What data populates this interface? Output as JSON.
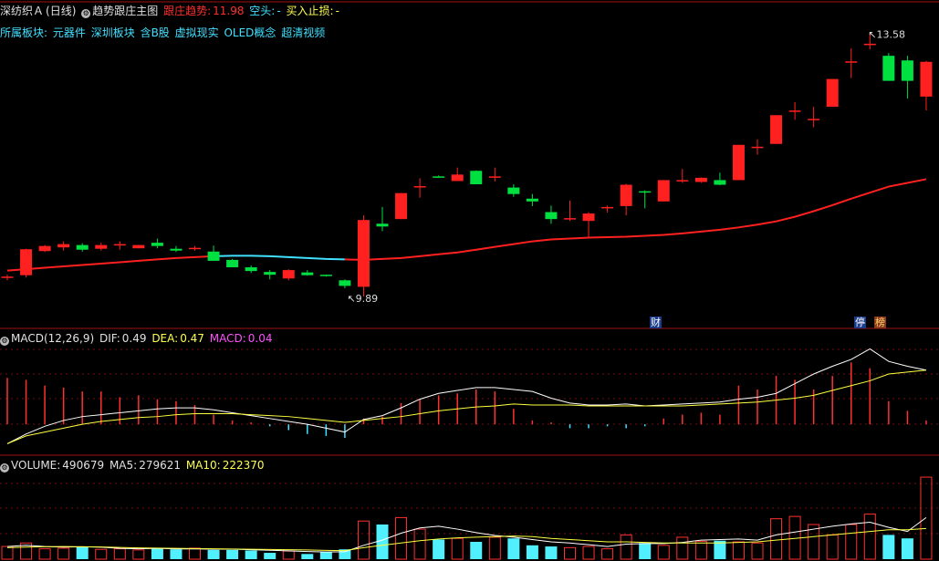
{
  "header": {
    "stock": "深纺织Ａ",
    "period": "(日线)",
    "main_name": "趋势跟庄主图",
    "trend_label": "跟庄趋势:",
    "trend_value": "11.98",
    "short_label": "空头:",
    "short_value": "-",
    "buy_label": "买入止损:",
    "buy_value": "-",
    "sector_label": "所属板块:",
    "sectors": [
      "元器件",
      "深圳板块",
      "含B股",
      "虚拟现实",
      "OLED概念",
      "超清视频"
    ]
  },
  "markers": {
    "cai": "财",
    "ting": "停",
    "bang": "榜"
  },
  "macd_header": {
    "name": "MACD(12,26,9)",
    "dif_label": "DIF:",
    "dif": "0.49",
    "dea_label": "DEA:",
    "dea": "0.47",
    "macd_label": "MACD:",
    "macd": "0.04"
  },
  "vol_header": {
    "name": "VOLUME:",
    "vol": "490679",
    "ma5_label": "MA5:",
    "ma5": "279621",
    "ma10_label": "MA10:",
    "ma10": "222370"
  },
  "colors": {
    "up": "#ff2020",
    "down": "#00e040",
    "trend_line": "#ff2020",
    "trend_line_alt": "#40e0ff",
    "dif": "#ffffff",
    "dea": "#ffff40"
  },
  "chart_data": [
    {
      "type": "candlestick",
      "name": "price",
      "annotations": [
        {
          "label": "13.58",
          "kind": "high"
        },
        {
          "label": "9.89",
          "kind": "low"
        }
      ],
      "ohlc": [
        [
          10.31,
          10.36,
          10.24,
          10.32
        ],
        [
          10.35,
          10.92,
          10.3,
          10.91
        ],
        [
          10.87,
          11.0,
          10.85,
          10.98
        ],
        [
          10.95,
          11.08,
          10.88,
          11.02
        ],
        [
          11.0,
          11.04,
          10.86,
          10.9
        ],
        [
          10.92,
          11.05,
          10.88,
          11.0
        ],
        [
          10.99,
          11.08,
          10.9,
          11.02
        ],
        [
          10.93,
          11.0,
          10.93,
          11.0
        ],
        [
          11.05,
          11.14,
          10.93,
          10.98
        ],
        [
          10.92,
          10.98,
          10.85,
          10.88
        ],
        [
          10.92,
          10.98,
          10.88,
          10.94
        ],
        [
          10.86,
          10.99,
          10.66,
          10.66
        ],
        [
          10.68,
          10.7,
          10.52,
          10.52
        ],
        [
          10.52,
          10.56,
          10.4,
          10.44
        ],
        [
          10.42,
          10.46,
          10.26,
          10.36
        ],
        [
          10.28,
          10.48,
          10.24,
          10.46
        ],
        [
          10.41,
          10.46,
          10.34,
          10.35
        ],
        [
          10.36,
          10.36,
          10.32,
          10.34
        ],
        [
          10.24,
          10.26,
          10.07,
          10.12
        ],
        [
          10.1,
          11.64,
          9.89,
          11.54
        ],
        [
          11.46,
          11.82,
          11.3,
          11.4
        ],
        [
          11.56,
          12.12,
          11.56,
          12.12
        ],
        [
          12.26,
          12.44,
          12.02,
          12.27
        ],
        [
          12.48,
          12.5,
          12.46,
          12.47
        ],
        [
          12.38,
          12.67,
          12.38,
          12.52
        ],
        [
          12.6,
          12.61,
          12.31,
          12.31
        ],
        [
          12.46,
          12.67,
          12.37,
          12.48
        ],
        [
          12.24,
          12.31,
          12.04,
          12.1
        ],
        [
          12.0,
          12.1,
          11.84,
          11.94
        ],
        [
          11.71,
          11.85,
          11.46,
          11.56
        ],
        [
          11.58,
          11.96,
          11.52,
          11.58
        ],
        [
          11.52,
          11.71,
          11.18,
          11.68
        ],
        [
          11.8,
          11.85,
          11.7,
          11.82
        ],
        [
          11.84,
          12.32,
          11.64,
          12.3
        ],
        [
          12.16,
          12.18,
          11.79,
          12.15
        ],
        [
          11.94,
          12.4,
          11.94,
          12.4
        ],
        [
          12.39,
          12.64,
          12.34,
          12.4
        ],
        [
          12.36,
          12.46,
          12.34,
          12.45
        ],
        [
          12.4,
          12.56,
          12.29,
          12.3
        ],
        [
          12.4,
          13.16,
          12.4,
          13.16
        ],
        [
          13.12,
          13.28,
          12.95,
          13.12
        ],
        [
          13.18,
          13.8,
          13.18,
          13.8
        ],
        [
          13.9,
          14.08,
          13.7,
          13.9
        ],
        [
          13.72,
          13.98,
          13.54,
          13.72
        ],
        [
          13.98,
          14.58,
          13.98,
          14.58
        ],
        [
          14.96,
          15.24,
          14.6,
          14.96
        ],
        [
          15.34,
          15.55,
          15.22,
          15.34
        ],
        [
          15.08,
          15.14,
          14.54,
          14.54
        ],
        [
          14.98,
          15.08,
          14.16,
          14.54
        ],
        [
          14.2,
          14.97,
          13.9,
          14.95
        ]
      ],
      "trend_line": [
        10.45,
        10.48,
        10.51,
        10.54,
        10.57,
        10.6,
        10.63,
        10.66,
        10.69,
        10.72,
        10.74,
        10.76,
        10.77,
        10.77,
        10.76,
        10.74,
        10.72,
        10.7,
        10.69,
        10.68,
        10.7,
        10.72,
        10.76,
        10.8,
        10.84,
        10.9,
        10.96,
        11.02,
        11.08,
        11.12,
        11.14,
        11.16,
        11.17,
        11.18,
        11.2,
        11.22,
        11.25,
        11.29,
        11.33,
        11.38,
        11.44,
        11.51,
        11.61,
        11.73,
        11.86,
        12.0,
        12.13,
        12.26,
        12.34,
        12.42
      ],
      "trend_alt_range": [
        11,
        18
      ]
    },
    {
      "type": "bar+line",
      "name": "MACD",
      "macd": [
        0.48,
        0.46,
        0.4,
        0.38,
        0.34,
        0.34,
        0.28,
        0.3,
        0.26,
        0.24,
        0.2,
        0.1,
        0.04,
        0.02,
        -0.02,
        -0.06,
        -0.1,
        -0.12,
        -0.14,
        0.06,
        0.08,
        0.22,
        0.26,
        0.3,
        0.32,
        0.36,
        0.34,
        0.16,
        0.04,
        0.02,
        -0.04,
        -0.04,
        -0.02,
        -0.04,
        -0.02,
        0.06,
        0.1,
        0.12,
        0.1,
        0.4,
        0.36,
        0.5,
        0.46,
        0.36,
        0.5,
        0.64,
        0.58,
        0.24,
        0.14,
        0.04
      ],
      "dif": [
        -0.2,
        -0.1,
        -0.02,
        0.04,
        0.08,
        0.1,
        0.12,
        0.14,
        0.16,
        0.17,
        0.17,
        0.15,
        0.12,
        0.09,
        0.06,
        0.03,
        0.0,
        -0.04,
        -0.08,
        0.05,
        0.09,
        0.17,
        0.26,
        0.32,
        0.35,
        0.38,
        0.38,
        0.36,
        0.34,
        0.27,
        0.22,
        0.2,
        0.2,
        0.21,
        0.19,
        0.2,
        0.21,
        0.22,
        0.23,
        0.26,
        0.28,
        0.32,
        0.42,
        0.52,
        0.6,
        0.67,
        0.78,
        0.65,
        0.6,
        0.56
      ],
      "dea": [
        -0.2,
        -0.12,
        -0.08,
        -0.04,
        0.0,
        0.03,
        0.05,
        0.07,
        0.08,
        0.1,
        0.11,
        0.11,
        0.11,
        0.1,
        0.09,
        0.08,
        0.06,
        0.04,
        0.02,
        0.04,
        0.06,
        0.08,
        0.11,
        0.14,
        0.16,
        0.18,
        0.19,
        0.21,
        0.2,
        0.2,
        0.2,
        0.19,
        0.19,
        0.19,
        0.19,
        0.19,
        0.19,
        0.2,
        0.21,
        0.22,
        0.23,
        0.25,
        0.27,
        0.3,
        0.35,
        0.4,
        0.45,
        0.52,
        0.54,
        0.56
      ],
      "ylim": [
        -0.3,
        0.85
      ]
    },
    {
      "type": "bar+line",
      "name": "VOLUME",
      "volume": [
        110000,
        140000,
        90000,
        95000,
        110000,
        85000,
        90000,
        80000,
        95000,
        85000,
        95000,
        80000,
        80000,
        75000,
        55000,
        70000,
        45000,
        60000,
        85000,
        330000,
        300000,
        360000,
        260000,
        170000,
        180000,
        150000,
        190000,
        180000,
        120000,
        110000,
        100000,
        110000,
        90000,
        210000,
        140000,
        120000,
        190000,
        155000,
        160000,
        150000,
        140000,
        350000,
        370000,
        300000,
        210000,
        300000,
        390000,
        210000,
        180000,
        710000
      ],
      "ma5": [
        110000,
        120000,
        110000,
        105000,
        108000,
        104000,
        94000,
        90000,
        94000,
        89000,
        89000,
        87000,
        87000,
        82000,
        77000,
        72000,
        66000,
        62000,
        64000,
        120000,
        165000,
        225000,
        270000,
        285000,
        260000,
        230000,
        205000,
        190000,
        170000,
        150000,
        140000,
        125000,
        110000,
        130000,
        135000,
        135000,
        145000,
        165000,
        170000,
        175000,
        165000,
        210000,
        235000,
        260000,
        285000,
        305000,
        320000,
        275000,
        240000,
        360000
      ],
      "ma10": [
        100000,
        105000,
        108000,
        110000,
        108000,
        106000,
        102000,
        98000,
        96000,
        94000,
        92000,
        90000,
        88000,
        86000,
        84000,
        82000,
        80000,
        76000,
        74000,
        100000,
        120000,
        140000,
        160000,
        175000,
        185000,
        190000,
        195000,
        200000,
        195000,
        180000,
        170000,
        160000,
        150000,
        150000,
        145000,
        140000,
        140000,
        140000,
        140000,
        145000,
        150000,
        165000,
        180000,
        195000,
        210000,
        225000,
        240000,
        255000,
        255000,
        265000
      ],
      "ylim": [
        0,
        750000
      ]
    }
  ]
}
